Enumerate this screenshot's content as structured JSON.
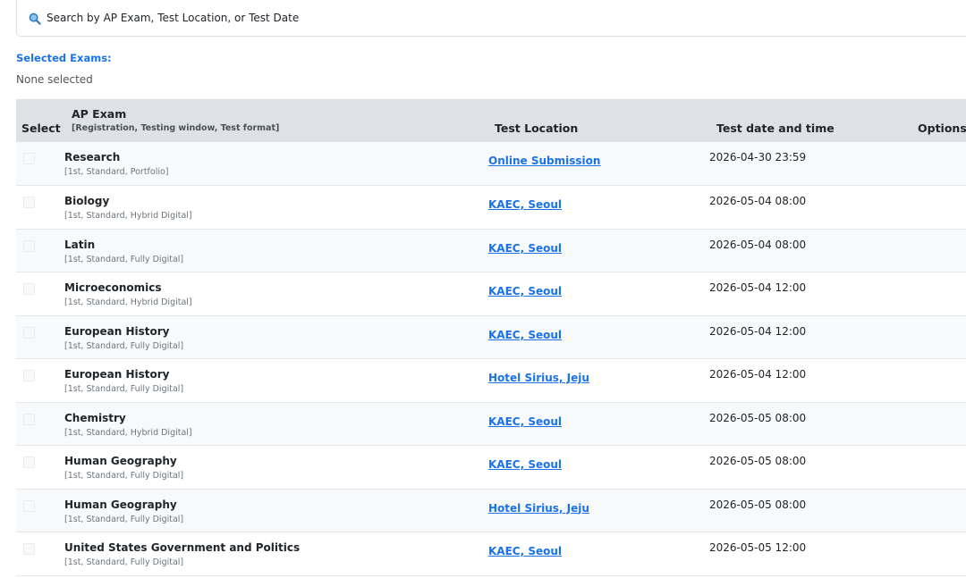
{
  "search": {
    "placeholder": "Search by AP Exam, Test Location, or Test Date",
    "icon": "search-icon"
  },
  "selected": {
    "label": "Selected Exams:",
    "value": "None selected"
  },
  "table": {
    "headers": {
      "select": "Select",
      "exam": "AP Exam",
      "exam_sub": "[Registration, Testing window, Test format]",
      "location": "Test Location",
      "datetime": "Test date and time",
      "options": "Options"
    },
    "rows": [
      {
        "exam": "Research",
        "meta": "[1st, Standard, Portfolio]",
        "location": "Online Submission",
        "datetime": "2026-04-30 23:59"
      },
      {
        "exam": "Biology",
        "meta": "[1st, Standard, Hybrid Digital]",
        "location": "KAEC, Seoul",
        "datetime": "2026-05-04 08:00"
      },
      {
        "exam": "Latin",
        "meta": "[1st, Standard, Fully Digital]",
        "location": "KAEC, Seoul",
        "datetime": "2026-05-04 08:00"
      },
      {
        "exam": "Microeconomics",
        "meta": "[1st, Standard, Hybrid Digital]",
        "location": "KAEC, Seoul",
        "datetime": "2026-05-04 12:00"
      },
      {
        "exam": "European History",
        "meta": "[1st, Standard, Fully Digital]",
        "location": "KAEC, Seoul",
        "datetime": "2026-05-04 12:00"
      },
      {
        "exam": "European History",
        "meta": "[1st, Standard, Fully Digital]",
        "location": "Hotel Sirius, Jeju",
        "datetime": "2026-05-04 12:00"
      },
      {
        "exam": "Chemistry",
        "meta": "[1st, Standard, Hybrid Digital]",
        "location": "KAEC, Seoul",
        "datetime": "2026-05-05 08:00"
      },
      {
        "exam": "Human Geography",
        "meta": "[1st, Standard, Fully Digital]",
        "location": "KAEC, Seoul",
        "datetime": "2026-05-05 08:00"
      },
      {
        "exam": "Human Geography",
        "meta": "[1st, Standard, Fully Digital]",
        "location": "Hotel Sirius, Jeju",
        "datetime": "2026-05-05 08:00"
      },
      {
        "exam": "United States Government and Politics",
        "meta": "[1st, Standard, Fully Digital]",
        "location": "KAEC, Seoul",
        "datetime": "2026-05-05 12:00"
      }
    ]
  },
  "colors": {
    "accent": "#1a73e8",
    "header_bg": "#dee2e6",
    "row_alt_bg": "#f8f9fa"
  }
}
